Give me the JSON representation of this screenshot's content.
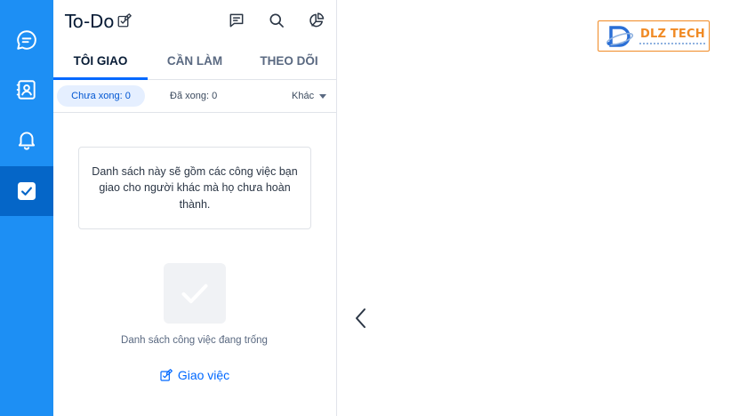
{
  "nav": {
    "items": [
      {
        "name": "messages",
        "icon": "chat-bubble-icon",
        "active": false
      },
      {
        "name": "contacts",
        "icon": "contact-card-icon",
        "active": false
      },
      {
        "name": "notifications",
        "icon": "bell-icon",
        "active": false
      },
      {
        "name": "todo",
        "icon": "checkbox-icon",
        "active": true
      }
    ]
  },
  "panel": {
    "title": "To-Do",
    "header_icons": [
      "edit-icon",
      "message-square-icon",
      "search-icon",
      "pie-chart-icon"
    ]
  },
  "tabs": [
    {
      "label": "TÔI GIAO",
      "active": true
    },
    {
      "label": "CẦN LÀM",
      "active": false
    },
    {
      "label": "THEO DÕI",
      "active": false
    }
  ],
  "filters": {
    "pending": "Chưa xong: 0",
    "done": "Đã xong: 0",
    "other": "Khác"
  },
  "info": {
    "text": "Danh sách này sẽ gồm các công việc bạn giao cho người khác mà họ chưa hoàn thành."
  },
  "empty": {
    "text": "Danh sách công việc đang trống",
    "action_label": "Giao việc"
  },
  "logo": {
    "text": "DLZ TECH"
  },
  "colors": {
    "rail": "#1d8ff4",
    "rail_active": "#0566c8",
    "accent": "#0068ff",
    "chip_bg": "#e5efff",
    "logo_orange": "#f08a24"
  }
}
